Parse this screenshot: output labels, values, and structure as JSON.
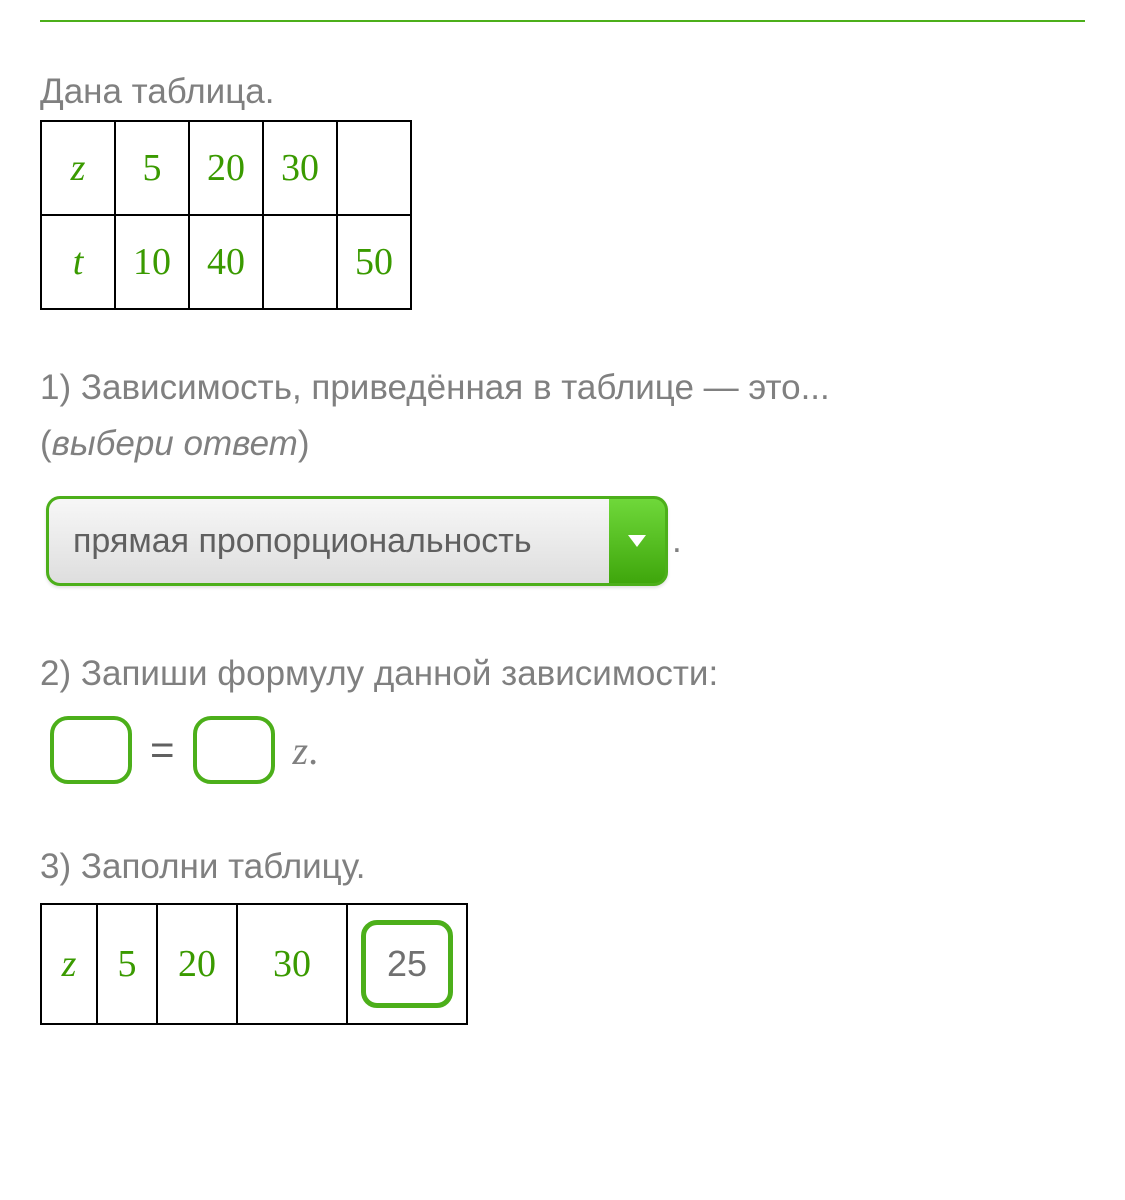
{
  "intro": "Дана таблица.",
  "table1": {
    "rows": [
      {
        "var": "z",
        "cells": [
          "5",
          "20",
          "30",
          ""
        ]
      },
      {
        "var": "t",
        "cells": [
          "10",
          "40",
          "",
          "50"
        ]
      }
    ]
  },
  "q1": {
    "prompt_line1": "1) Зависимость, приведённая в таблице — это...",
    "prompt_hint": "выбери ответ",
    "selected": "прямая пропорциональность",
    "trail": "."
  },
  "q2": {
    "prompt": "2) Запиши формулу данной зависимости:",
    "eq": "=",
    "var": "z",
    "trail": "."
  },
  "q3": {
    "prompt": "3) Заполни таблицу.",
    "row": {
      "var": "z",
      "cells": [
        "5",
        "20",
        "30"
      ],
      "input_value": "25"
    }
  }
}
